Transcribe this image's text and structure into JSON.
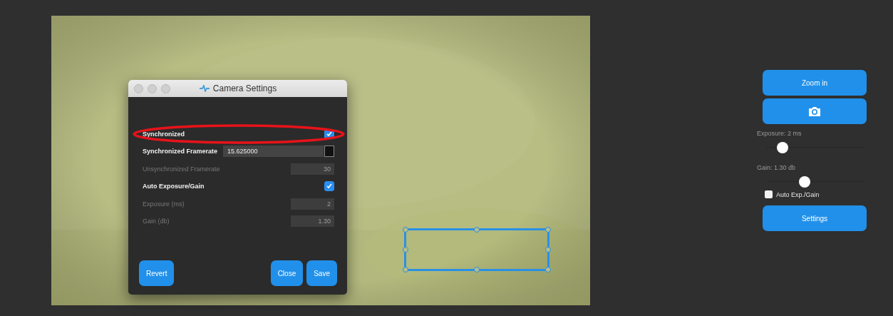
{
  "dialog": {
    "title": "Camera Settings",
    "rows": [
      {
        "kind": "checkbox",
        "label": "Synchronized",
        "checked": true,
        "highlighted": true
      },
      {
        "kind": "field",
        "label": "Synchronized Framerate",
        "value": "15.625000",
        "disabled": false,
        "highlighted": false
      },
      {
        "kind": "field",
        "label": "Unsynchronized Framerate",
        "value": "30",
        "disabled": true,
        "highlighted": false
      },
      {
        "kind": "checkbox",
        "label": "Auto Exposure/Gain",
        "checked": true,
        "highlighted": false
      },
      {
        "kind": "field",
        "label": "Exposure (ms)",
        "value": "2",
        "disabled": true,
        "highlighted": false
      },
      {
        "kind": "field",
        "label": "Gain (db)",
        "value": "1.30",
        "disabled": true,
        "highlighted": false
      }
    ],
    "buttons": [
      "Revert",
      "Close",
      "Save"
    ]
  },
  "side_panel": {
    "zoom_button": "Zoom in",
    "sliders": [
      {
        "label": "Exposure: 2 ms",
        "level": 0.17
      },
      {
        "label": "Gain: 1.30 db",
        "level": 0.4
      }
    ],
    "auto_checkbox": {
      "label": "Auto Exp./Gain",
      "checked": false
    },
    "settings_button": "Settings"
  }
}
